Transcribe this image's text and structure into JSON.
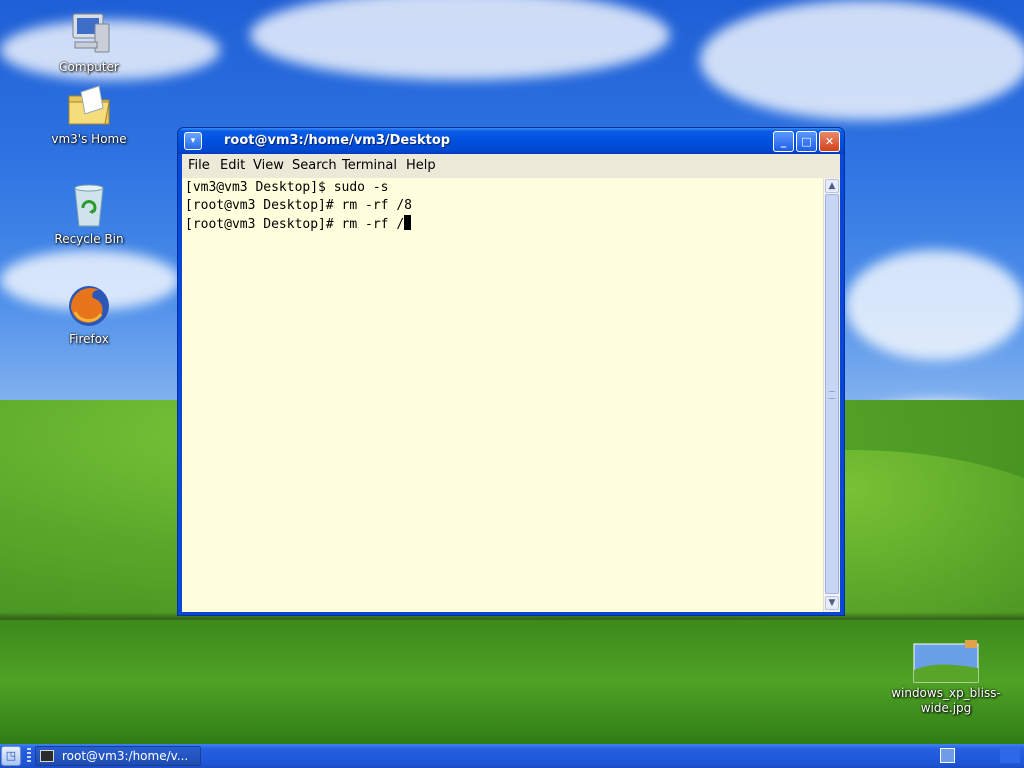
{
  "desktop": {
    "icons": [
      {
        "label": "Computer",
        "icon": "computer-icon"
      },
      {
        "label": "vm3's Home",
        "icon": "home-folder-icon"
      },
      {
        "label": "Recycle Bin",
        "icon": "recycle-bin-icon"
      },
      {
        "label": "Firefox",
        "icon": "firefox-icon"
      }
    ],
    "file_icon": {
      "line1": "windows_xp_bliss-",
      "line2": "wide.jpg",
      "icon": "image-file-icon"
    }
  },
  "window": {
    "title": "root@vm3:/home/vm3/Desktop",
    "menu": [
      "File",
      "Edit",
      "View",
      "Search",
      "Terminal",
      "Help"
    ],
    "buttons": {
      "minimize": "minimize-icon",
      "maximize": "maximize-icon",
      "close": "close-icon"
    },
    "terminal_lines": [
      "[vm3@vm3 Desktop]$ sudo -s",
      "[root@vm3 Desktop]# rm -rf /8",
      "[root@vm3 Desktop]# rm -rf /"
    ],
    "terminal_bg": "#ffffdd"
  },
  "taskbar": {
    "task_label": "root@vm3:/home/v..."
  },
  "colors": {
    "title_bar": "#0050dd",
    "taskbar": "#2560e0",
    "menu_bg": "#ece9d8"
  }
}
